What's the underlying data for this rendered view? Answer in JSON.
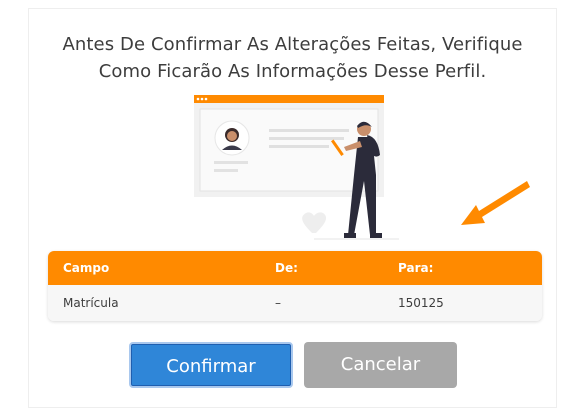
{
  "modal": {
    "title_line1": "Antes De Confirmar As Alterações Feitas, Verifique",
    "title_line2": "Como Ficarão As Informações Desse Perfil."
  },
  "colors": {
    "accent": "#ff8a00",
    "primary": "#2f86d8",
    "secondary": "#a8a8a8"
  },
  "table": {
    "headers": [
      "Campo",
      "De:",
      "Para:"
    ],
    "rows": [
      [
        "Matrícula",
        "–",
        "150125"
      ]
    ]
  },
  "buttons": {
    "confirm": "Confirmar",
    "cancel": "Cancelar"
  },
  "icons": {
    "illustration": "person-editing-profile-illustration",
    "arrow": "arrow-icon"
  }
}
